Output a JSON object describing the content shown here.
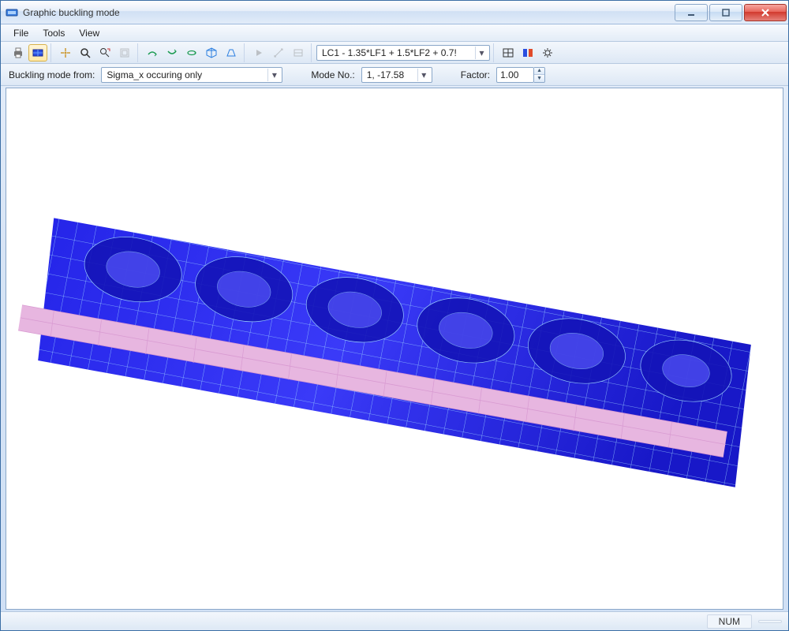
{
  "window": {
    "title": "Graphic buckling mode"
  },
  "menu": {
    "file": "File",
    "tools": "Tools",
    "view": "View"
  },
  "toolbar": {
    "loadcase_combo": "LC1 - 1.35*LF1 + 1.5*LF2 + 0.7!"
  },
  "filters": {
    "mode_from_label": "Buckling mode from:",
    "mode_from_value": "Sigma_x occuring only",
    "mode_no_label": "Mode No.:",
    "mode_no_value": "1, -17.58",
    "factor_label": "Factor:",
    "factor_value": "1.00"
  },
  "status": {
    "num": "NUM"
  },
  "colors": {
    "mesh_dark": "#1818c8",
    "mesh_mid": "#2a2af0",
    "mesh_light": "#6c6cff",
    "mesh_line": "#9fd8ff",
    "stiffener": "#e7b6e0",
    "stiffener_line": "#d89ad1"
  }
}
